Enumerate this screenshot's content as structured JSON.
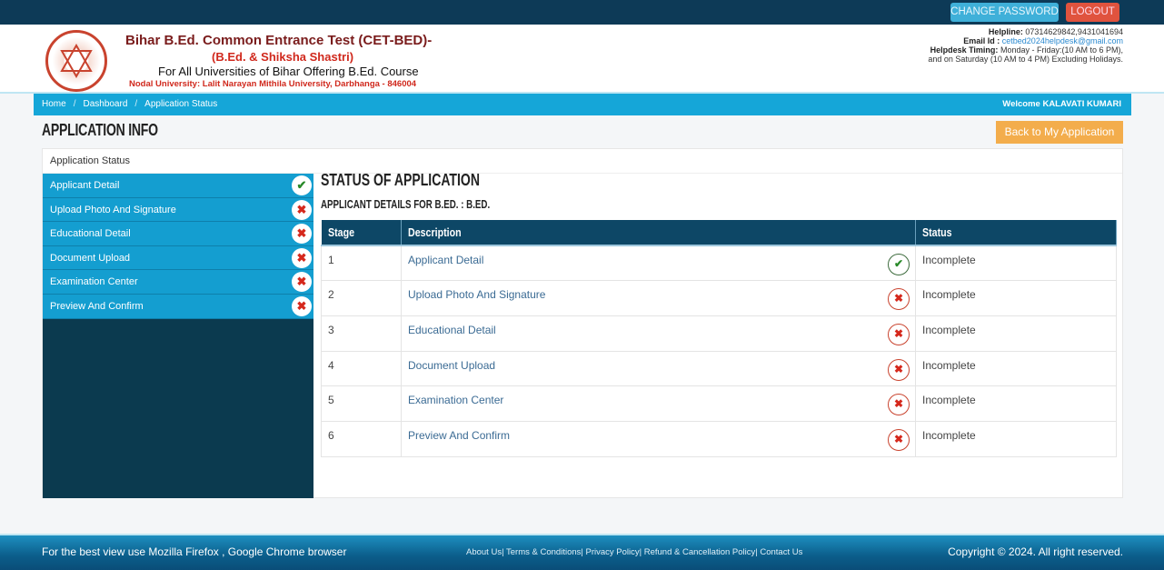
{
  "topbar": {
    "change_password": "CHANGE PASSWORD",
    "logout": "LOGOUT"
  },
  "header": {
    "title": "Bihar B.Ed. Common Entrance Test (CET-BED)-",
    "subtitle": "(B.Ed. & Shiksha Shastri)",
    "tagline": "For All Universities of Bihar Offering B.Ed. Course",
    "nodal": "Nodal University: Lalit Narayan Mithila University, Darbhanga - 846004",
    "helpline_label": "Helpline:",
    "helpline": "07314629842,9431041694",
    "email_label": "Email Id :",
    "email": "cetbed2024helpdesk@gmail.com",
    "timing_label": "Helpdesk Timing:",
    "timing": "Monday - Friday:(10 AM to 6 PM),",
    "timing2": "and on Saturday (10 AM to 4 PM) Excluding Holidays."
  },
  "breadcrumb": [
    "Home",
    "Dashboard",
    "Application Status"
  ],
  "welcome": "Welcome KALAVATI KUMARI",
  "page_title": "APPLICATION INFO",
  "back_button": "Back to My Application",
  "panel_title": "Application Status",
  "sidebar": [
    {
      "label": "Applicant Detail",
      "done": true
    },
    {
      "label": "Upload Photo And Signature",
      "done": false
    },
    {
      "label": "Educational Detail",
      "done": false
    },
    {
      "label": "Document Upload",
      "done": false
    },
    {
      "label": "Examination Center",
      "done": false
    },
    {
      "label": "Preview And Confirm",
      "done": false
    }
  ],
  "main": {
    "title": "STATUS OF APPLICATION",
    "subtitle": "APPLICANT DETAILS FOR B.ED. : B.ED.",
    "columns": [
      "Stage",
      "Description",
      "Status"
    ],
    "rows": [
      {
        "stage": "1",
        "description": "Applicant Detail",
        "done": true,
        "status": "Incomplete"
      },
      {
        "stage": "2",
        "description": "Upload Photo And Signature",
        "done": false,
        "status": "Incomplete"
      },
      {
        "stage": "3",
        "description": "Educational Detail",
        "done": false,
        "status": "Incomplete"
      },
      {
        "stage": "4",
        "description": "Document Upload",
        "done": false,
        "status": "Incomplete"
      },
      {
        "stage": "5",
        "description": "Examination Center",
        "done": false,
        "status": "Incomplete"
      },
      {
        "stage": "6",
        "description": "Preview And Confirm",
        "done": false,
        "status": "Incomplete"
      }
    ]
  },
  "footer": {
    "browser_note": "For the best view use Mozilla Firefox , Google Chrome browser",
    "links": [
      "About Us",
      "Terms & Conditions",
      "Privacy Policy",
      "Refund & Cancellation Policy",
      "Contact Us"
    ],
    "copyright": "Copyright © 2024. All right reserved."
  },
  "icons": {
    "done": "check-icon",
    "not_done": "cross-icon"
  }
}
